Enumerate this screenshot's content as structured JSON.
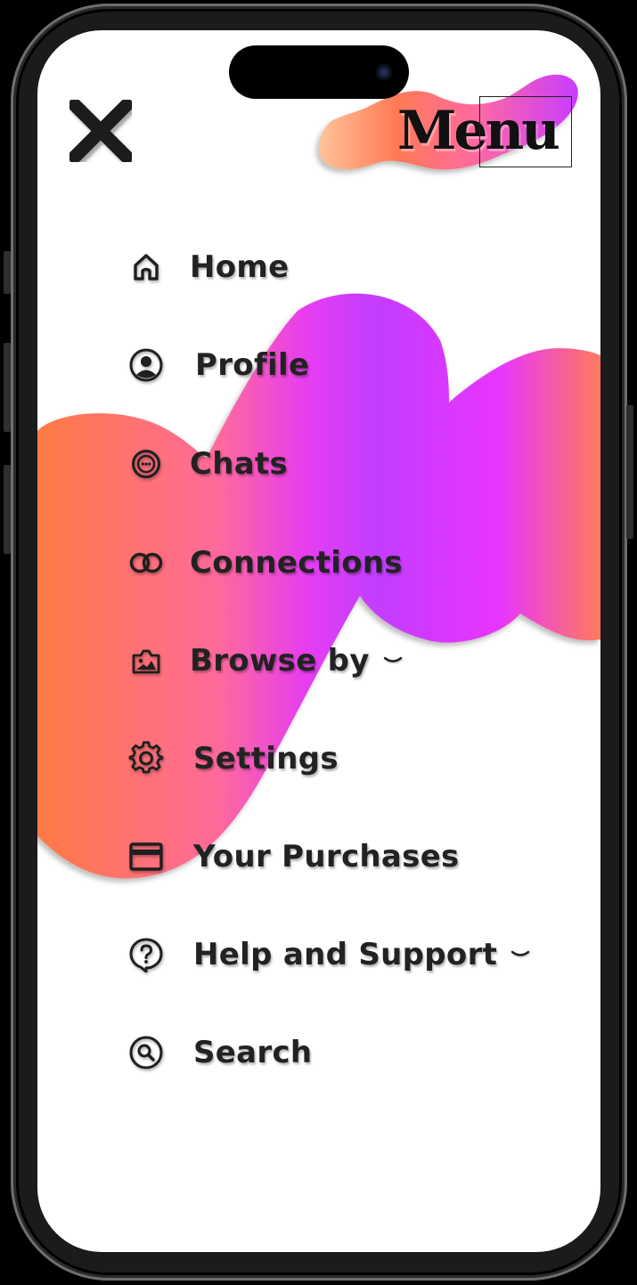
{
  "header": {
    "title": "Menu",
    "close_icon": "close-icon"
  },
  "nav": {
    "items": [
      {
        "label": "Home",
        "icon": "home-icon"
      },
      {
        "label": "Profile",
        "icon": "user-circle-icon"
      },
      {
        "label": "Chats",
        "icon": "chat-bubble-icon"
      },
      {
        "label": "Connections",
        "icon": "linked-rings-icon"
      },
      {
        "label": "Browse by",
        "icon": "image-gallery-icon",
        "has_dropdown": true
      },
      {
        "label": "Settings",
        "icon": "gear-icon"
      },
      {
        "label": "Your Purchases",
        "icon": "credit-card-icon"
      },
      {
        "label": "Help and Support",
        "icon": "help-bubble-icon",
        "has_dropdown": true
      },
      {
        "label": "Search",
        "icon": "search-icon"
      }
    ]
  },
  "colors": {
    "gradient_orange": "#ff7a45",
    "gradient_pink": "#ff6a9a",
    "gradient_magenta": "#d83cff",
    "gradient_purple": "#b32bff",
    "text": "#222222",
    "background": "#ffffff"
  }
}
